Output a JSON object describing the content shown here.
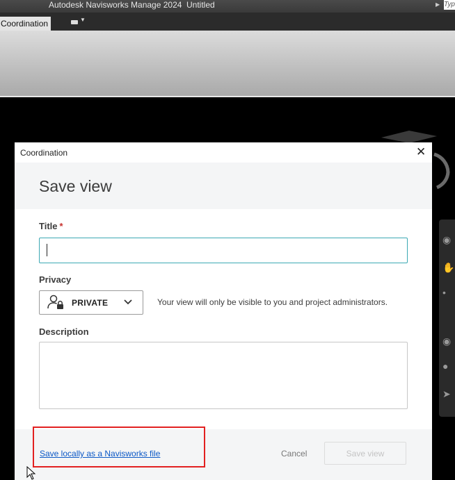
{
  "window": {
    "app_title": "Autodesk Navisworks Manage 2024",
    "doc_title": "Untitled",
    "search_stub": "Typ"
  },
  "ribbon": {
    "active_tab": "Coordination"
  },
  "dialog": {
    "caption": "Coordination",
    "heading": "Save view",
    "title_label": "Title",
    "title_required_mark": "*",
    "title_value": "",
    "privacy_label": "Privacy",
    "privacy_value": "PRIVATE",
    "privacy_note": "Your view will only be visible to you and project administrators.",
    "description_label": "Description",
    "description_value": "",
    "save_local_link": "Save locally as a Navisworks file",
    "cancel_label": "Cancel",
    "save_label": "Save view"
  },
  "colors": {
    "accent_focus": "#3ba8b3",
    "link": "#0b58c6",
    "required": "#c7312e",
    "highlight": "#e22020"
  },
  "icons": {
    "close": "close-icon",
    "privacy": "user-lock-icon",
    "dropdown": "chevron-down-icon"
  }
}
